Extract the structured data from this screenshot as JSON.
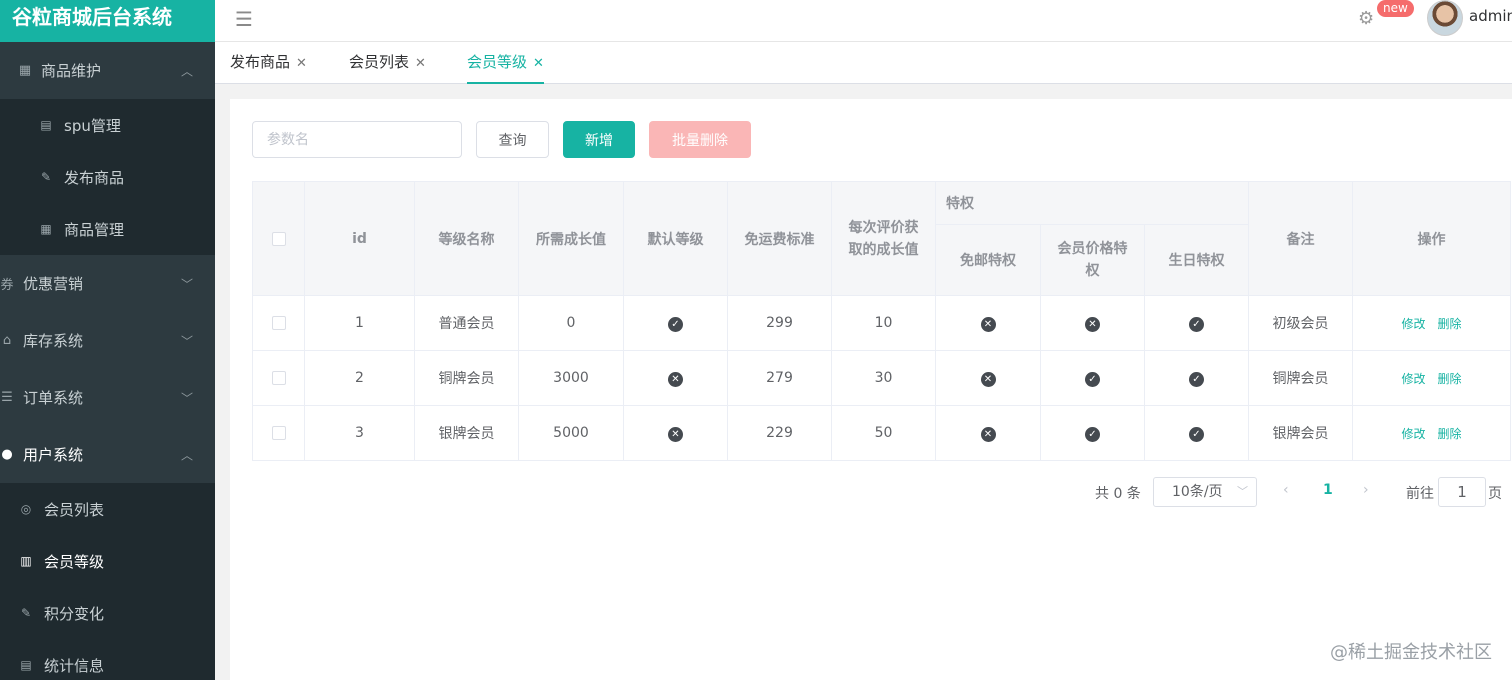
{
  "app": {
    "title": "谷粒商城后台系统"
  },
  "header": {
    "badge": "new",
    "user": "admin"
  },
  "sidebar": {
    "groups": [
      {
        "label": "商品维护",
        "icon": "grid-icon",
        "open": true,
        "items": [
          {
            "label": "spu管理",
            "icon": "document-gear-icon"
          },
          {
            "label": "发布商品",
            "icon": "edit-icon"
          },
          {
            "label": "商品管理",
            "icon": "grid-icon"
          }
        ]
      },
      {
        "label": "优惠营销",
        "icon": "coupon-icon",
        "open": false
      },
      {
        "label": "库存系统",
        "icon": "home-icon",
        "open": false
      },
      {
        "label": "订单系统",
        "icon": "order-icon",
        "open": false
      },
      {
        "label": "用户系统",
        "icon": "user-icon",
        "open": true,
        "items": [
          {
            "label": "会员列表",
            "icon": "user-circle-icon"
          },
          {
            "label": "会员等级",
            "icon": "bar-chart-icon",
            "active": true
          },
          {
            "label": "积分变化",
            "icon": "edit-icon"
          },
          {
            "label": "统计信息",
            "icon": "document-icon"
          }
        ]
      }
    ]
  },
  "tabs": [
    {
      "label": "发布商品",
      "active": false
    },
    {
      "label": "会员列表",
      "active": false
    },
    {
      "label": "会员等级",
      "active": true
    }
  ],
  "toolbar": {
    "search_placeholder": "参数名",
    "query_label": "查询",
    "add_label": "新增",
    "batch_delete_label": "批量删除"
  },
  "table": {
    "headers": {
      "id": "id",
      "name": "等级名称",
      "growth": "所需成长值",
      "default": "默认等级",
      "free_shipping": "免运费标准",
      "comment_growth": "每次评价获取的成长值",
      "privilege": "特权",
      "free_ship_priv": "免邮特权",
      "member_price": "会员价格特权",
      "birthday": "生日特权",
      "note": "备注",
      "ops": "操作"
    },
    "rows": [
      {
        "id": "1",
        "name": "普通会员",
        "growth": "0",
        "default": true,
        "free_shipping": "299",
        "comment_growth": "10",
        "free_ship_priv": false,
        "member_price": false,
        "birthday": true,
        "note": "初级会员"
      },
      {
        "id": "2",
        "name": "铜牌会员",
        "growth": "3000",
        "default": false,
        "free_shipping": "279",
        "comment_growth": "30",
        "free_ship_priv": false,
        "member_price": true,
        "birthday": true,
        "note": "铜牌会员"
      },
      {
        "id": "3",
        "name": "银牌会员",
        "growth": "5000",
        "default": false,
        "free_shipping": "229",
        "comment_growth": "50",
        "free_ship_priv": false,
        "member_price": true,
        "birthday": true,
        "note": "银牌会员"
      }
    ],
    "edit_label": "修改",
    "delete_label": "删除"
  },
  "pagination": {
    "total_text": "共 0 条",
    "page_size": "10条/页",
    "current_page": "1",
    "goto_label": "前往",
    "goto_value": "1",
    "page_suffix": "页"
  },
  "watermark": "@稀土掘金技术社区",
  "colors": {
    "accent": "#17b3a3",
    "sidebar": "#253136",
    "danger_light": "#fab6b6"
  }
}
